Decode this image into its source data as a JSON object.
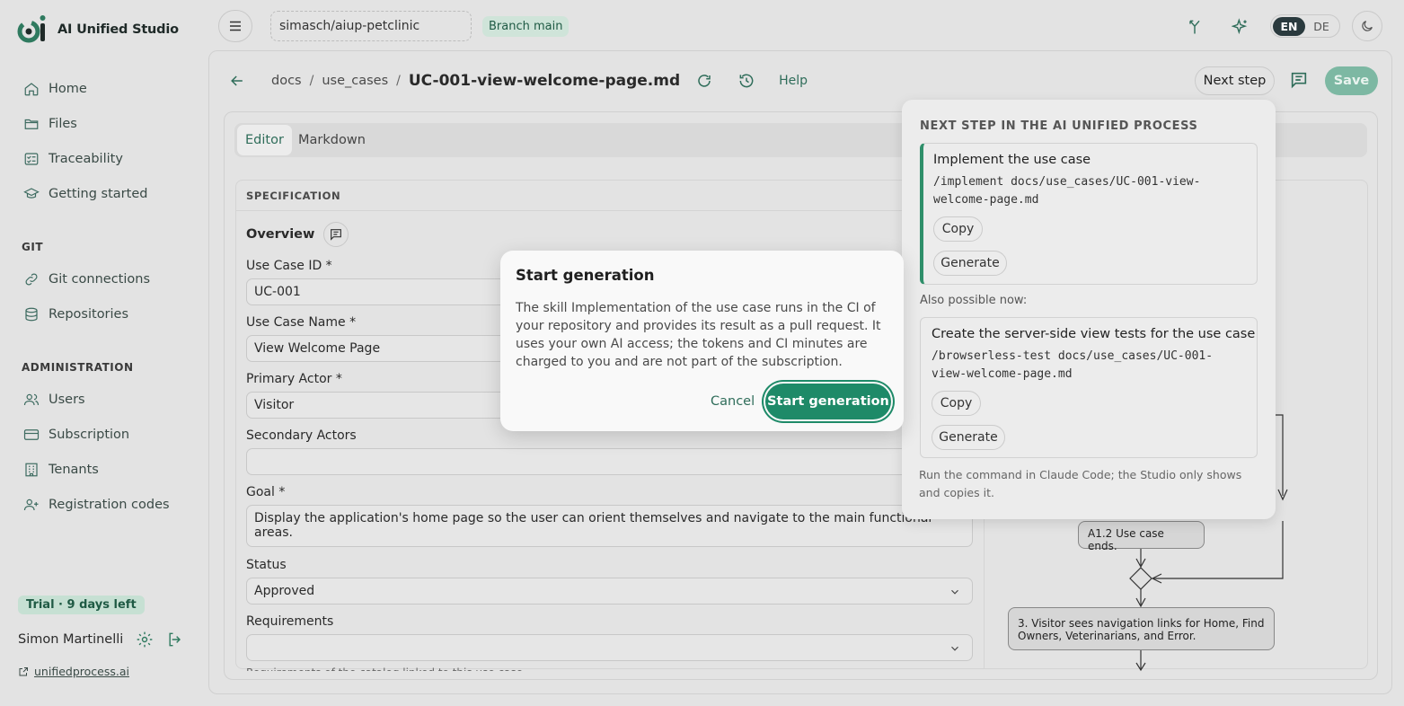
{
  "app": {
    "title": "AI Unified Studio"
  },
  "sidebar": {
    "items": [
      {
        "label": "Home",
        "icon": "home-icon"
      },
      {
        "label": "Files",
        "icon": "folder-icon"
      },
      {
        "label": "Traceability",
        "icon": "checklist-icon"
      },
      {
        "label": "Getting started",
        "icon": "graduation-cap-icon"
      }
    ],
    "git_section": "GIT",
    "git_items": [
      {
        "label": "Git connections",
        "icon": "link-icon"
      },
      {
        "label": "Repositories",
        "icon": "database-icon"
      }
    ],
    "admin_section": "ADMINISTRATION",
    "admin_items": [
      {
        "label": "Users",
        "icon": "users-icon"
      },
      {
        "label": "Subscription",
        "icon": "credit-card-icon"
      },
      {
        "label": "Tenants",
        "icon": "building-icon"
      },
      {
        "label": "Registration codes",
        "icon": "user-plus-icon"
      }
    ],
    "trial_badge": "Trial · 9 days left",
    "user_name": "Simon Martinelli",
    "external_link": "unifiedprocess.ai"
  },
  "topbar": {
    "repo": "simasch/aiup-petclinic",
    "branch": "Branch main",
    "lang_en": "EN",
    "lang_de": "DE"
  },
  "breadcrumb": {
    "part1": "docs",
    "part2": "use_cases",
    "file": "UC-001-view-welcome-page.md",
    "help": "Help",
    "next_step": "Next step",
    "save": "Save"
  },
  "editor": {
    "tab_editor": "Editor",
    "tab_markdown": "Markdown",
    "spec_header": "SPECIFICATION",
    "overview": "Overview",
    "fields": {
      "use_case_id_label": "Use Case ID *",
      "use_case_id_value": "UC-001",
      "use_case_name_label": "Use Case Name *",
      "use_case_name_value": "View Welcome Page",
      "primary_actor_label": "Primary Actor *",
      "primary_actor_value": "Visitor",
      "secondary_actors_label": "Secondary Actors",
      "secondary_actors_value": "",
      "goal_label": "Goal *",
      "goal_value": "Display the application's home page so the user can orient themselves and navigate to the main functional areas.",
      "status_label": "Status",
      "status_value": "Approved",
      "requirements_label": "Requirements",
      "requirements_value": "",
      "requirements_hint": "Requirements of the catalog linked to this use case"
    }
  },
  "flow": {
    "node_a12": "A1.2 Use case ends.",
    "node_3": "3. Visitor sees navigation links for Home, Find Owners, Veterinarians, and Error."
  },
  "next_step_popover": {
    "title": "NEXT STEP IN THE AI UNIFIED PROCESS",
    "primary_title": "Implement the use case",
    "primary_cmd": "/implement docs/use_cases/UC-001-view-welcome-page.md",
    "copy": "Copy",
    "generate": "Generate",
    "also_possible": "Also possible now:",
    "secondary_title": "Create the server-side view tests for the use case",
    "secondary_cmd": "/browserless-test docs/use_cases/UC-001-view-welcome-page.md",
    "note": "Run the command in Claude Code; the Studio only shows and copies it."
  },
  "modal": {
    "title": "Start generation",
    "body": "The skill Implementation of the use case runs in the CI of your repository and provides its result as a pull request. It uses your own AI access; the tokens and CI minutes are charged to you and are not part of the subscription.",
    "cancel": "Cancel",
    "confirm": "Start generation"
  },
  "colors": {
    "accent": "#1e8a68",
    "brand_text": "#2f6d5a"
  }
}
